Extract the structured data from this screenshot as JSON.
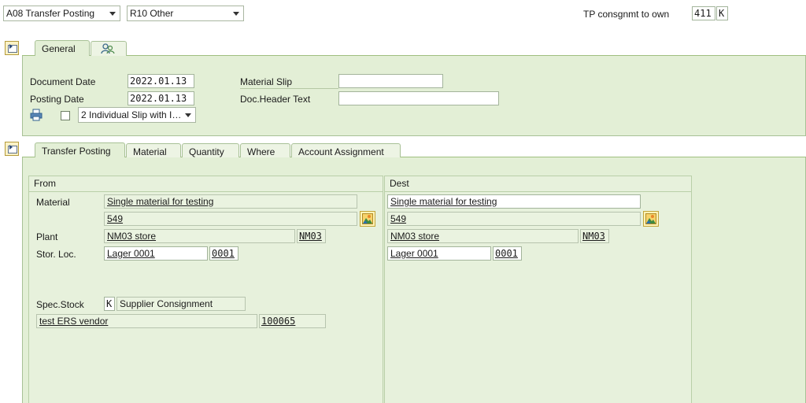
{
  "header": {
    "action_select": "A08 Transfer Posting",
    "reference_select": "R10 Other",
    "movement_label": "TP consgnmt to own",
    "movement_type": "411",
    "special_stock_indicator": "K"
  },
  "header_tabs": [
    {
      "label": "General"
    },
    {
      "label": "",
      "icon": "person-icon"
    }
  ],
  "general": {
    "document_date_label": "Document Date",
    "document_date": "2022.01.13",
    "posting_date_label": "Posting Date",
    "posting_date": "2022.01.13",
    "material_slip_label": "Material Slip",
    "material_slip": "",
    "doc_header_text_label": "Doc.Header Text",
    "doc_header_text": "",
    "print_version": "2 Individual Slip with I…"
  },
  "item_tabs": [
    {
      "label": "Transfer Posting"
    },
    {
      "label": "Material"
    },
    {
      "label": "Quantity"
    },
    {
      "label": "Where"
    },
    {
      "label": "Account Assignment"
    }
  ],
  "from": {
    "title": "From",
    "material_label": "Material",
    "material_desc": "Single material for testing",
    "material_no": "549",
    "plant_label": "Plant",
    "plant_desc": "NM03 store",
    "plant_code": "NM03",
    "sloc_label": "Stor. Loc.",
    "sloc_desc": "Lager 0001",
    "sloc_code": "0001",
    "spec_stock_label": "Spec.Stock",
    "spec_stock_code": "K",
    "spec_stock_desc": "Supplier Consignment",
    "vendor_desc": "test ERS vendor",
    "vendor_code": "100065"
  },
  "dest": {
    "title": "Dest",
    "material_desc": "Single material for testing",
    "material_no": "549",
    "plant_desc": "NM03 store",
    "plant_code": "NM03",
    "sloc_desc": "Lager 0001",
    "sloc_code": "0001"
  },
  "colors": {
    "panel": "#e3efd6",
    "panel_border": "#a8c196",
    "tab_strip_line": "#9fbf7f"
  }
}
